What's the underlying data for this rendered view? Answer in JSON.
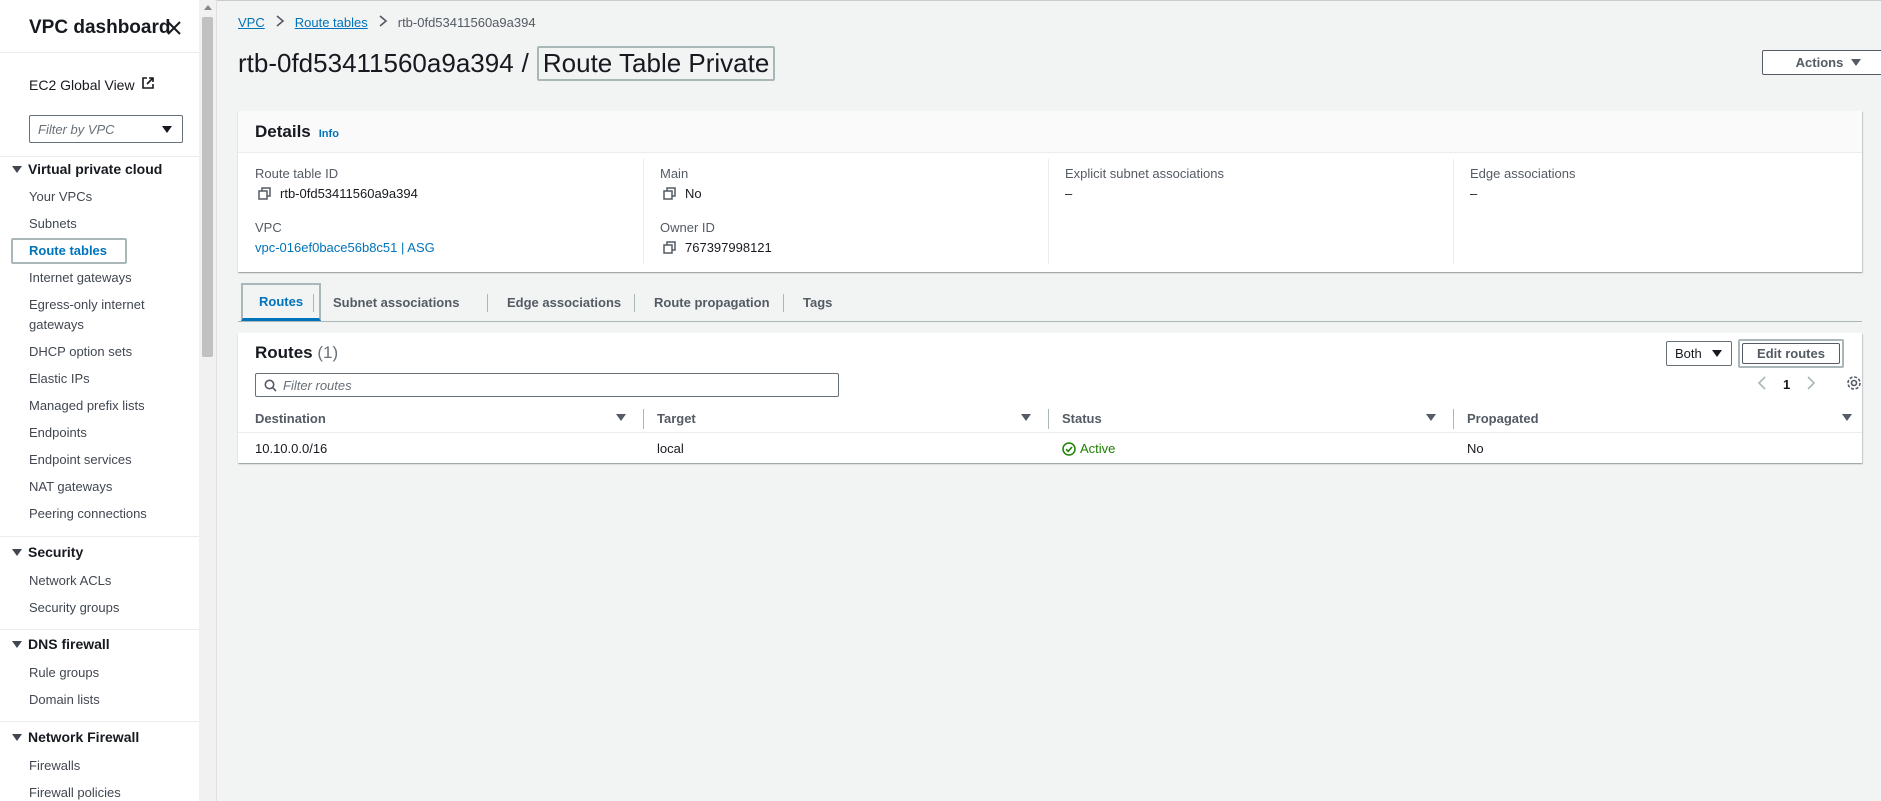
{
  "sidebar": {
    "title": "VPC dashboard",
    "ec2_global_view": "EC2 Global View",
    "filter_placeholder": "Filter by VPC",
    "sections": [
      {
        "title": "Virtual private cloud"
      },
      {
        "title": "Security"
      },
      {
        "title": "DNS firewall"
      },
      {
        "title": "Network Firewall"
      }
    ],
    "items": [
      {
        "label": "Your VPCs"
      },
      {
        "label": "Subnets"
      },
      {
        "label": "Route tables"
      },
      {
        "label": "Internet gateways"
      },
      {
        "label": "Egress-only internet gateways"
      },
      {
        "label": "DHCP option sets"
      },
      {
        "label": "Elastic IPs"
      },
      {
        "label": "Managed prefix lists"
      },
      {
        "label": "Endpoints"
      },
      {
        "label": "Endpoint services"
      },
      {
        "label": "NAT gateways"
      },
      {
        "label": "Peering connections"
      },
      {
        "label": "Network ACLs"
      },
      {
        "label": "Security groups"
      },
      {
        "label": "Rule groups"
      },
      {
        "label": "Domain lists"
      },
      {
        "label": "Firewalls"
      },
      {
        "label": "Firewall policies"
      }
    ]
  },
  "breadcrumb": {
    "vpc": "VPC",
    "route_tables": "Route tables",
    "current": "rtb-0fd53411560a9a394"
  },
  "page": {
    "title_id": "rtb-0fd53411560a9a394",
    "title_sep": "/",
    "title_name": "Route Table Private",
    "actions_label": "Actions"
  },
  "details": {
    "heading": "Details",
    "info": "Info",
    "route_table_id_label": "Route table ID",
    "route_table_id": "rtb-0fd53411560a9a394",
    "main_label": "Main",
    "main": "No",
    "explicit_label": "Explicit subnet associations",
    "explicit": "–",
    "edge_label": "Edge associations",
    "edge": "–",
    "vpc_label": "VPC",
    "vpc": "vpc-016ef0bace56b8c51 | ASG",
    "owner_label": "Owner ID",
    "owner": "767397998121"
  },
  "tabs": [
    {
      "label": "Routes"
    },
    {
      "label": "Subnet associations"
    },
    {
      "label": "Edge associations"
    },
    {
      "label": "Route propagation"
    },
    {
      "label": "Tags"
    }
  ],
  "routes": {
    "heading": "Routes",
    "count": "(1)",
    "filter_select": "Both",
    "edit_label": "Edit routes",
    "filter_placeholder": "Filter routes",
    "page": "1",
    "columns": [
      "Destination",
      "Target",
      "Status",
      "Propagated"
    ],
    "rows": [
      {
        "destination": "10.10.0.0/16",
        "target": "local",
        "status": "Active",
        "propagated": "No"
      }
    ]
  },
  "colors": {
    "accent": "#0073bb",
    "success": "#1d8102"
  }
}
